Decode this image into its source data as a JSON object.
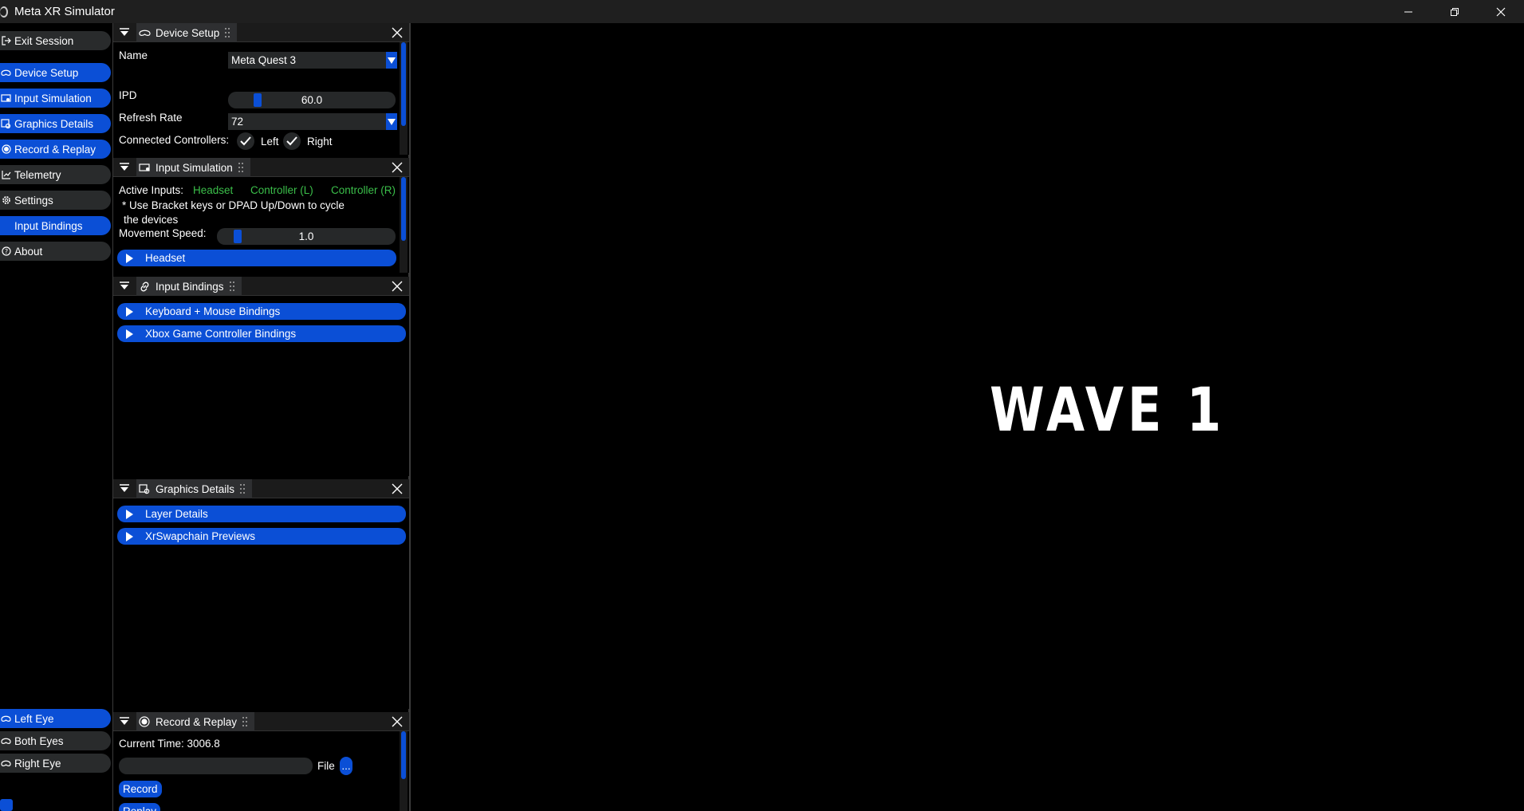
{
  "window": {
    "title": "Meta XR Simulator",
    "controls": [
      "minimize-icon",
      "restore-icon",
      "close-icon"
    ]
  },
  "sidebar": {
    "items": [
      {
        "label": "Exit Session",
        "icon": "exit-icon",
        "active": false
      },
      {
        "label": "Device Setup",
        "icon": "headset-icon",
        "active": true
      },
      {
        "label": "Input Simulation",
        "icon": "keyboard-icon",
        "active": true
      },
      {
        "label": "Graphics Details",
        "icon": "graphics-icon",
        "active": true
      },
      {
        "label": "Record & Replay",
        "icon": "record-icon",
        "active": true
      },
      {
        "label": "Telemetry",
        "icon": "chart-icon",
        "active": false
      },
      {
        "label": "Settings",
        "icon": "gear-icon",
        "active": false
      },
      {
        "label": "Input Bindings",
        "icon": "link-icon",
        "active": true
      },
      {
        "label": "About",
        "icon": "help-icon",
        "active": false
      }
    ],
    "eye_items": [
      {
        "label": "Left Eye",
        "icon": "eye-icon",
        "active": true
      },
      {
        "label": "Both Eyes",
        "icon": "eye-icon",
        "active": false
      },
      {
        "label": "Right Eye",
        "icon": "eye-icon",
        "active": false
      }
    ]
  },
  "device_setup": {
    "title": "Device Setup",
    "name_label": "Name",
    "name_value": "Meta Quest 3",
    "ipd_label": "IPD",
    "ipd_value": "60.0",
    "ipd_fraction": 0.16,
    "refresh_label": "Refresh Rate",
    "refresh_value": "72",
    "controllers_label": "Connected Controllers:",
    "left_label": "Left",
    "right_label": "Right",
    "left_checked": true,
    "right_checked": true
  },
  "input_simulation": {
    "title": "Input Simulation",
    "active_inputs_label": "Active Inputs:",
    "inputs": [
      "Headset",
      "Controller (L)",
      "Controller (R)"
    ],
    "hint": "* Use Bracket keys or DPAD Up/Down to cycle the devices",
    "speed_label": "Movement Speed:",
    "speed_value": "1.0",
    "headset_label": "Headset"
  },
  "input_bindings": {
    "title": "Input Bindings",
    "keyboard_label": "Keyboard + Mouse Bindings",
    "xbox_label": "Xbox Game Controller Bindings"
  },
  "graphics_details": {
    "title": "Graphics Details",
    "layer_label": "Layer Details",
    "swapchain_label": "XrSwapchain Previews"
  },
  "record_replay": {
    "title": "Record & Replay",
    "current_time": "Current Time: 3006.8",
    "file_label": "File",
    "browse_label": "...",
    "record_label": "Record",
    "replay_label": "Replay"
  },
  "viewport": {
    "text": "WAVE 1"
  },
  "colors": {
    "accent": "#0b4fd6",
    "green": "#3bbf4a",
    "panel_bg": "#000000",
    "control_bg": "#262829"
  }
}
